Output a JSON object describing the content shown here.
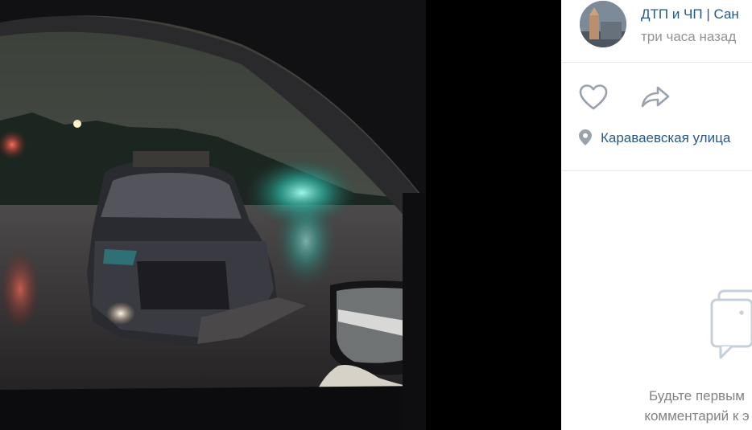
{
  "post": {
    "author": "ДТП и ЧП | Сан",
    "time": "три часа назад",
    "location": "Караваевская улица"
  },
  "comments": {
    "empty_line1": "Будьте первым",
    "empty_line2": "комментарий к э"
  },
  "icons": {
    "like": "heart-icon",
    "share": "share-arrow-icon",
    "location": "map-pin-icon",
    "comments": "comment-bubble-icon"
  },
  "colors": {
    "link": "#2a5885",
    "muted": "#939393",
    "icon": "#99a2ad"
  }
}
